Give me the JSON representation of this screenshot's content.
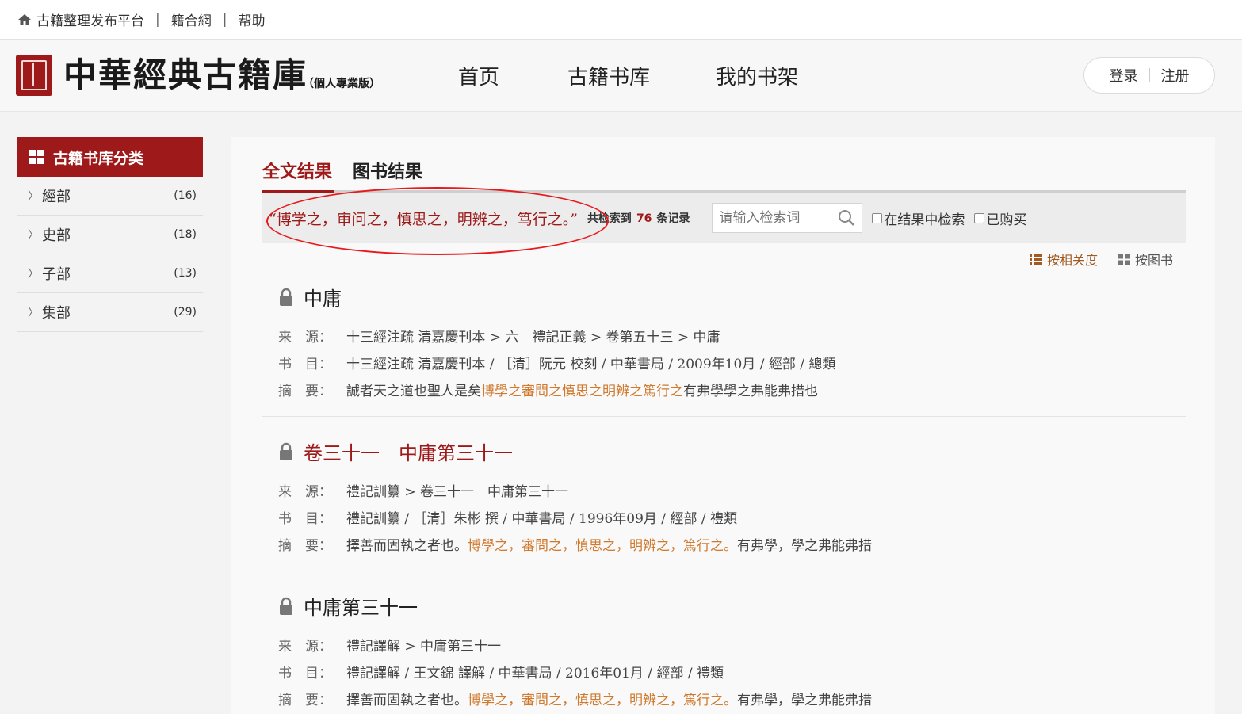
{
  "topbar": {
    "links": [
      "古籍整理发布平台",
      "籍合網",
      "帮助"
    ]
  },
  "header": {
    "logo_title": "中華經典古籍庫",
    "logo_sub": "（個人專業版）",
    "nav": [
      "首页",
      "古籍书库",
      "我的书架"
    ],
    "login": "登录",
    "register": "注册"
  },
  "sidebar": {
    "heading": "古籍书库分类",
    "items": [
      {
        "label": "經部",
        "count": "(16)"
      },
      {
        "label": "史部",
        "count": "(18)"
      },
      {
        "label": "子部",
        "count": "(13)"
      },
      {
        "label": "集部",
        "count": "(29)"
      }
    ]
  },
  "main": {
    "tabs": [
      "全文结果",
      "图书结果"
    ],
    "query": "“博学之，审问之，慎思之，明辨之，笃行之。”",
    "found_prefix": "共检索到",
    "found_count": "76",
    "found_suffix": "条记录",
    "search_placeholder": "请输入检索词",
    "check_in_results": "在结果中检索",
    "check_purchased": "已购买",
    "sort_relevance": "按相关度",
    "sort_book": "按图书",
    "labels": {
      "source": "来　源：",
      "catalog": "书　目：",
      "abstract": "摘　要："
    }
  },
  "results": [
    {
      "title": "中庸",
      "source": "十三經注疏 清嘉慶刊本 > 六　禮記正義 > 卷第五十三 > 中庸",
      "catalog": "十三經注疏 清嘉慶刊本 / ［清］阮元 校刻 / 中華書局 / 2009年10月 / 經部 / 總類",
      "abstract_pre": "誠者天之道也聖人是矣",
      "abstract_hl": "博學之審問之慎思之明辨之篤行之",
      "abstract_post": "有弗學學之弗能弗措也"
    },
    {
      "title": "卷三十一　中庸第三十一",
      "source": "禮記訓纂 > 卷三十一　中庸第三十一",
      "catalog": "禮記訓纂 / ［清］朱彬 撰 / 中華書局 / 1996年09月 / 經部 / 禮類",
      "abstract_pre": "擇善而固執之者也。",
      "abstract_hl": "博學之，審問之，慎思之，明辨之，篤行之。",
      "abstract_post": "有弗學，學之弗能弗措"
    },
    {
      "title": "中庸第三十一",
      "source": "禮記譯解 > 中庸第三十一",
      "catalog": "禮記譯解 / 王文錦 譯解 / 中華書局 / 2016年01月 / 經部 / 禮類",
      "abstract_pre": "擇善而固執之者也。",
      "abstract_hl": "博學之，審問之，慎思之，明辨之，篤行之。",
      "abstract_post": "有弗學，學之弗能弗措"
    }
  ]
}
